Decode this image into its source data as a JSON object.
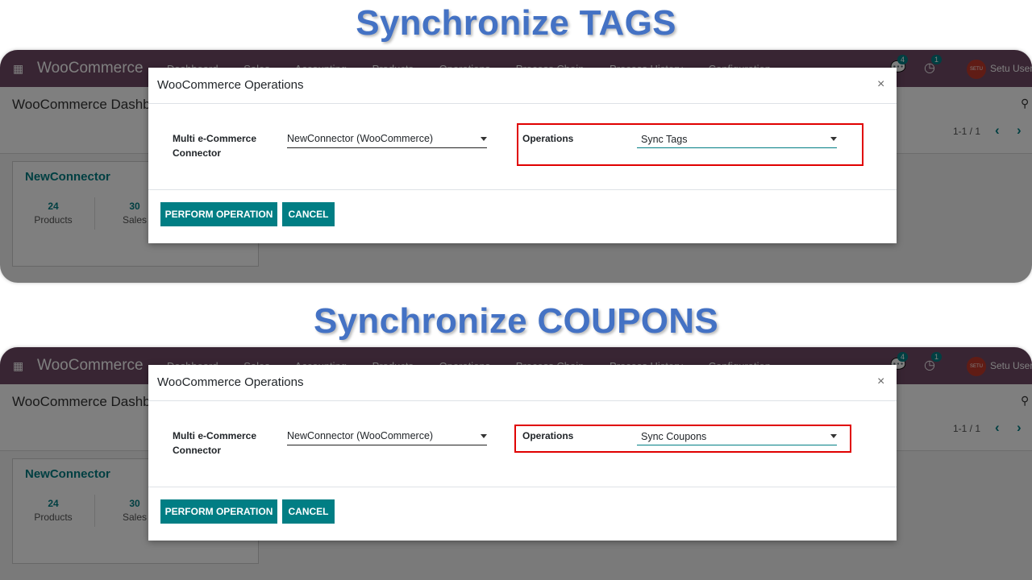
{
  "headings": {
    "tags": "Synchronize TAGS",
    "coupons": "Synchronize COUPONS"
  },
  "app": {
    "brand": "WooCommerce",
    "menu": [
      "Dashboard",
      "Sales",
      "Accounting",
      "Products",
      "Operations",
      "Process Chain",
      "Process History",
      "Configuration"
    ],
    "messages_count": "4",
    "activities_count": "1",
    "avatar_text": "SETU",
    "user_name": "Setu User",
    "page_title": "WooCommerce Dashboard",
    "pager": "1-1 / 1",
    "card": {
      "title": "NewConnector",
      "stats": [
        {
          "value": "24",
          "label": "Products"
        },
        {
          "value": "30",
          "label": "Sales"
        }
      ]
    }
  },
  "dialog": {
    "title": "WooCommerce Operations",
    "close": "×",
    "connector_label": "Multi e-Commerce Connector",
    "connector_value": "NewConnector (WooCommerce)",
    "operations_label": "Operations",
    "perform_button": "PERFORM OPERATION",
    "cancel_button": "CANCEL"
  },
  "panels": [
    {
      "operation_value": "Sync Tags"
    },
    {
      "operation_value": "Sync Coupons"
    }
  ],
  "colors": {
    "heading": "#4472c4",
    "navbar": "#714b67",
    "primary": "#017e84",
    "highlight": "#e00000"
  }
}
